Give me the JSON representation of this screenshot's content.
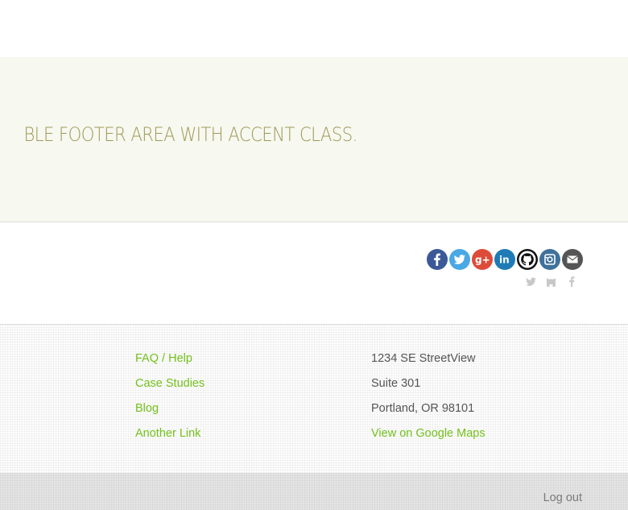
{
  "accent": {
    "text": "BLE FOOTER AREA WITH ACCENT CLASS.",
    "color": "#9e9a57",
    "background": "#f7f8f0"
  },
  "social": {
    "icons": [
      {
        "name": "facebook-icon",
        "color": "#3b5998"
      },
      {
        "name": "twitter-icon",
        "color": "#4aa8e5"
      },
      {
        "name": "google-plus-icon",
        "color": "#dd4b39"
      },
      {
        "name": "linkedin-icon",
        "color": "#1f7bb6"
      },
      {
        "name": "github-icon",
        "color": "#111111"
      },
      {
        "name": "instagram-icon",
        "color": "#3f729b"
      },
      {
        "name": "email-icon",
        "color": "#555555"
      }
    ],
    "mini_icons": [
      "twitter-icon",
      "github-icon",
      "facebook-icon"
    ]
  },
  "footer_links": {
    "col1": [
      "FAQ / Help",
      "Case Studies",
      "Blog",
      "Another Link"
    ],
    "address": {
      "line1": "1234 SE StreetView",
      "line2": "Suite 301",
      "line3": "Portland, OR 98101",
      "map_link": "View on Google Maps"
    },
    "link_color": "#74c01d"
  },
  "bottom": {
    "logout": "Log out"
  }
}
